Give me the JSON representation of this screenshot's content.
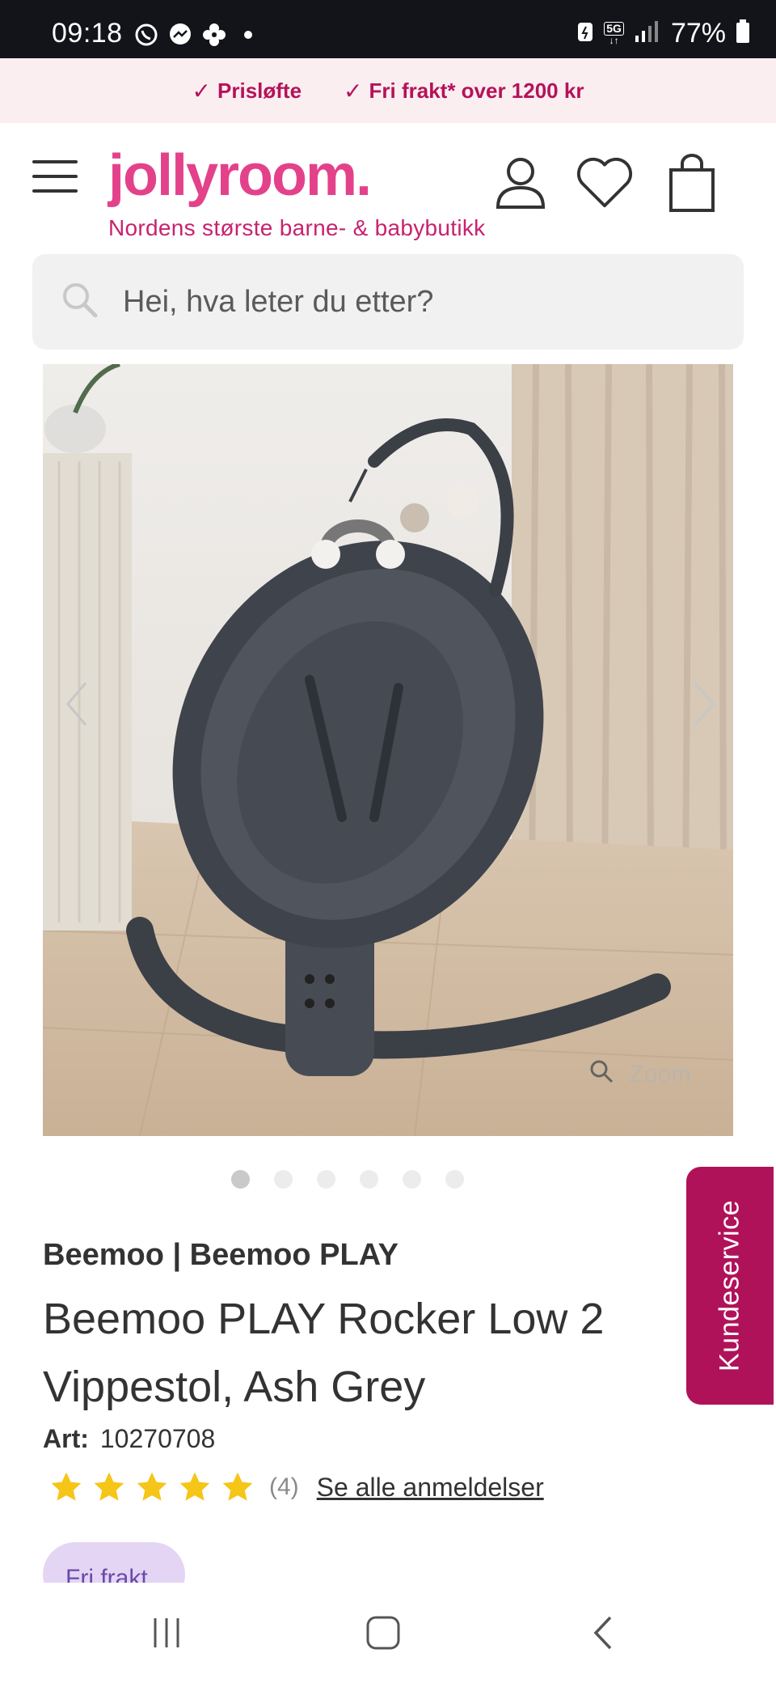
{
  "status_bar": {
    "time": "09:18",
    "network": "5G",
    "battery": "77%"
  },
  "promo": {
    "items": [
      "Prisløfte",
      "Fri frakt* over 1200 kr"
    ]
  },
  "header": {
    "logo": "jollyroom.",
    "tagline": "Nordens største barne- & babybutikk"
  },
  "search": {
    "placeholder": "Hei, hva leter du etter?"
  },
  "gallery": {
    "zoom_label": "Zoom",
    "image_count": 6,
    "active_index": 0
  },
  "product": {
    "brand": "Beemoo | Beemoo PLAY",
    "title": "Beemoo PLAY Rocker Low 2 Vippestol, Ash Grey",
    "art_label": "Art:",
    "art_number": "10270708",
    "rating": 5,
    "rating_count": "(4)",
    "reviews_link": "Se alle anmeldelser",
    "badge": "Fri frakt"
  },
  "customer_service": {
    "label": "Kundeservice"
  },
  "colors": {
    "brand_pink": "#e3428b",
    "accent_magenta": "#b0125a",
    "promo_bg": "#fbeef0",
    "star": "#f5c518",
    "badge_bg": "#e4d5f5"
  }
}
